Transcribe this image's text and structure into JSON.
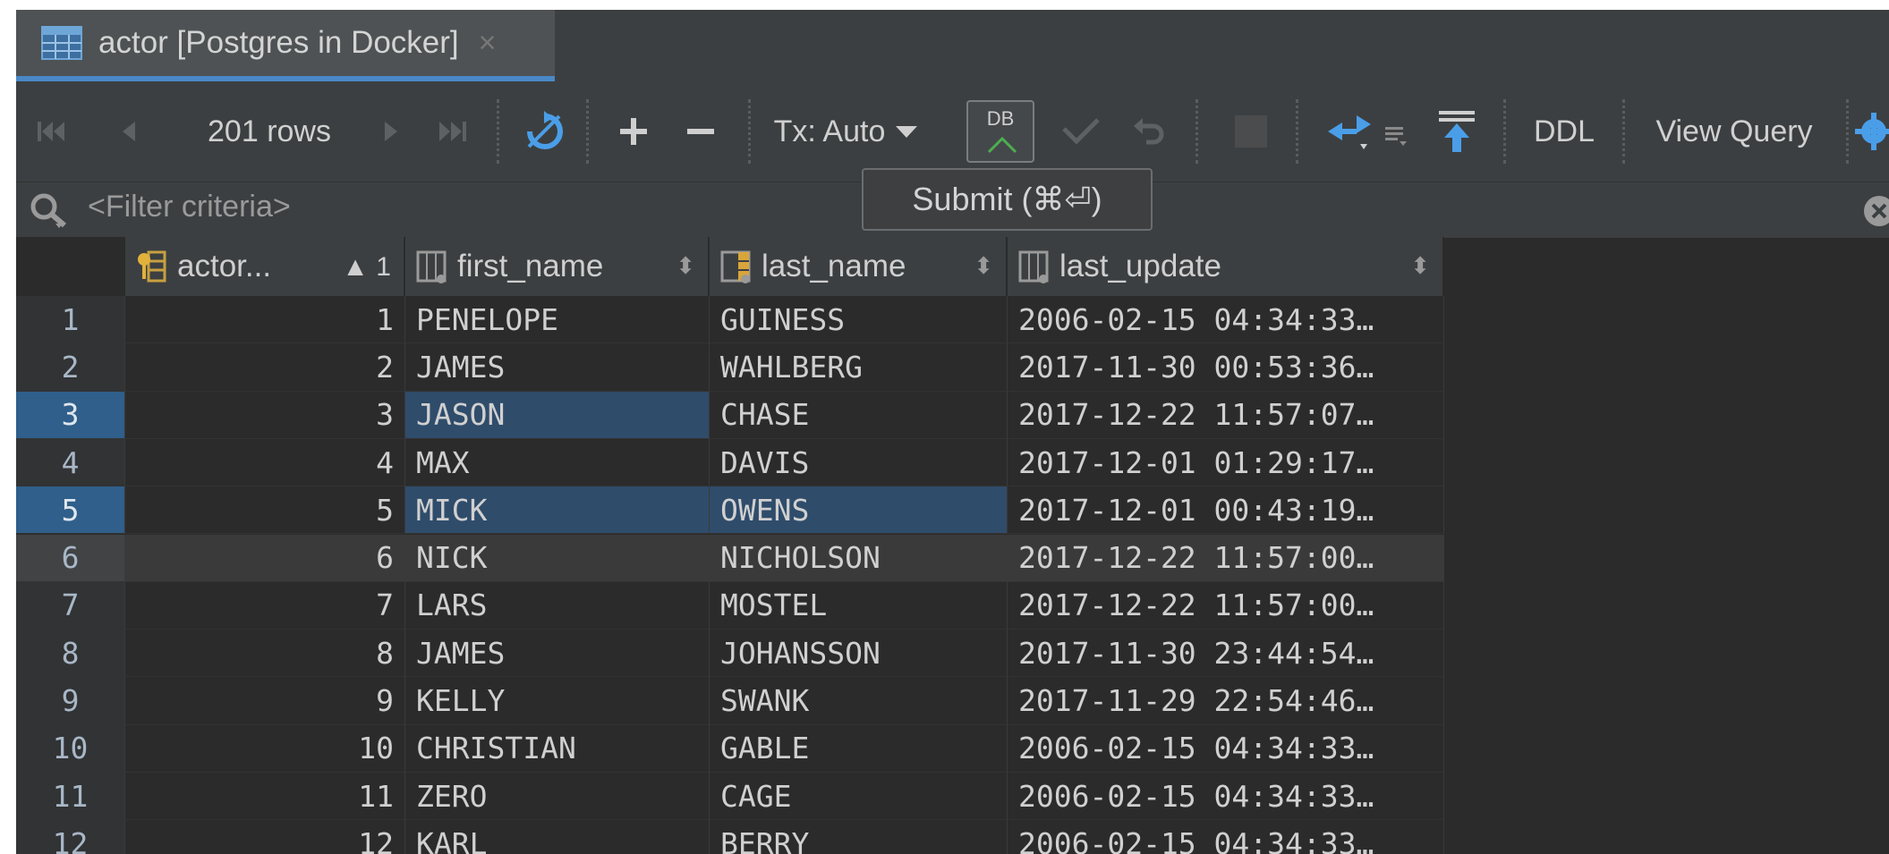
{
  "tab": {
    "title": "actor [Postgres in Docker]"
  },
  "toolbar": {
    "rows": "201 rows",
    "tx": "Tx: Auto",
    "db_label": "DB",
    "ddl": "DDL",
    "view_query": "View Query"
  },
  "tooltip": {
    "text": "Submit (⌘⏎)"
  },
  "filter": {
    "placeholder": "<Filter criteria>"
  },
  "columns": [
    {
      "name": "actor...",
      "sort": "▲ 1"
    },
    {
      "name": "first_name",
      "sort": "⬍"
    },
    {
      "name": "last_name",
      "sort": "⬍"
    },
    {
      "name": "last_update",
      "sort": "⬍"
    }
  ],
  "rows": [
    {
      "num": "1",
      "id": "1",
      "first": "PENELOPE",
      "last": "GUINESS",
      "update": "2006-02-15 04:34:33…"
    },
    {
      "num": "2",
      "id": "2",
      "first": "JAMES",
      "last": "WAHLBERG",
      "update": "2017-11-30 00:53:36…"
    },
    {
      "num": "3",
      "id": "3",
      "first": "JASON",
      "last": "CHASE",
      "update": "2017-12-22 11:57:07…"
    },
    {
      "num": "4",
      "id": "4",
      "first": "MAX",
      "last": "DAVIS",
      "update": "2017-12-01 01:29:17…"
    },
    {
      "num": "5",
      "id": "5",
      "first": "MICK",
      "last": "OWENS",
      "update": "2017-12-01 00:43:19…"
    },
    {
      "num": "6",
      "id": "6",
      "first": "NICK",
      "last": "NICHOLSON",
      "update": "2017-12-22 11:57:00…"
    },
    {
      "num": "7",
      "id": "7",
      "first": "LARS",
      "last": "MOSTEL",
      "update": "2017-12-22 11:57:00…"
    },
    {
      "num": "8",
      "id": "8",
      "first": "JAMES",
      "last": "JOHANSSON",
      "update": "2017-11-30 23:44:54…"
    },
    {
      "num": "9",
      "id": "9",
      "first": "KELLY",
      "last": "SWANK",
      "update": "2017-11-29 22:54:46…"
    },
    {
      "num": "10",
      "id": "10",
      "first": "CHRISTIAN",
      "last": "GABLE",
      "update": "2006-02-15 04:34:33…"
    },
    {
      "num": "11",
      "id": "11",
      "first": "ZERO",
      "last": "CAGE",
      "update": "2006-02-15 04:34:33…"
    },
    {
      "num": "12",
      "id": "12",
      "first": "KARL",
      "last": "BERRY",
      "update": "2006-02-15 04:34:33…"
    }
  ]
}
